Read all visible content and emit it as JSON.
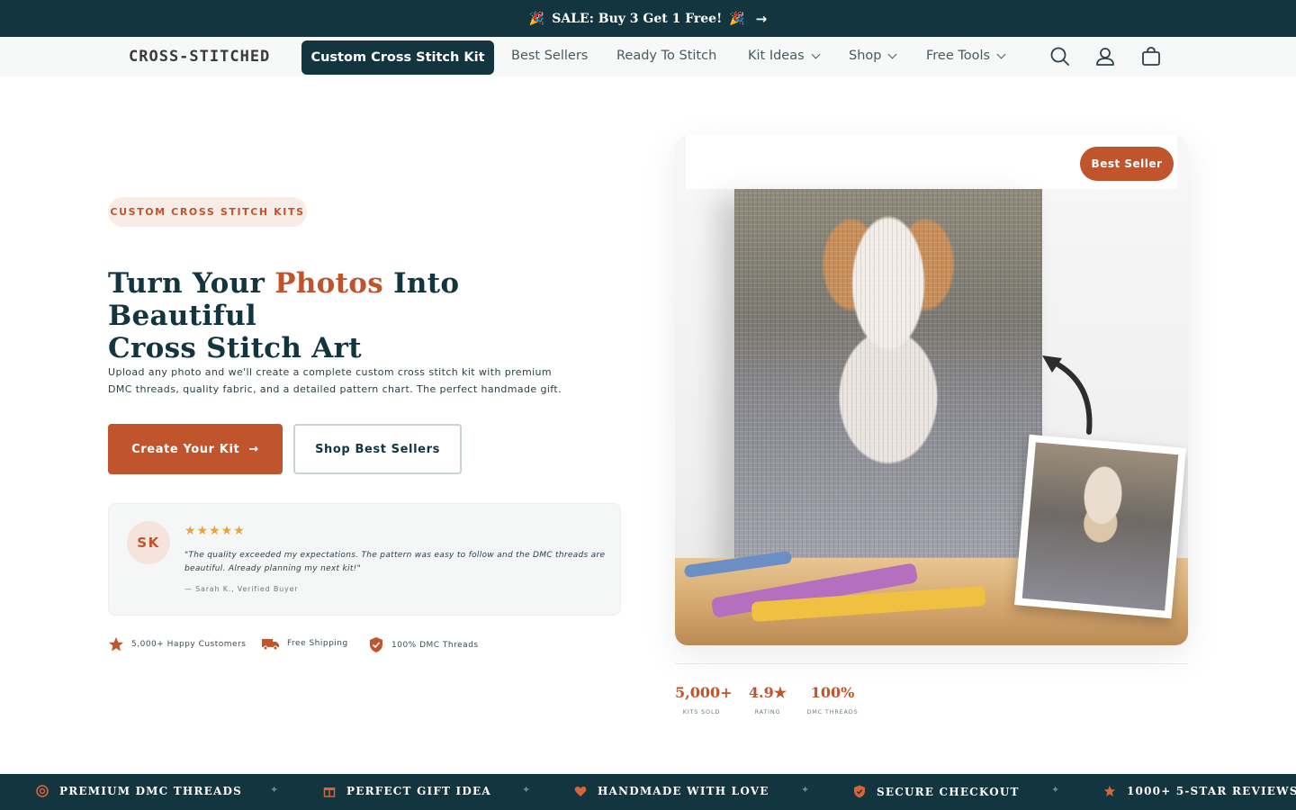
{
  "announcement": {
    "emoji_left": "🎉",
    "text": "SALE: Buy 3 Get 1 Free!",
    "emoji_right": "🎉",
    "arrow": "→"
  },
  "nav": {
    "logo": "CROSS-STITCHED",
    "primary_button": "Custom Cross Stitch Kit",
    "links": [
      {
        "label": "Best Sellers",
        "dropdown": false
      },
      {
        "label": "Ready To Stitch",
        "dropdown": false
      },
      {
        "label": "Kit Ideas",
        "dropdown": true
      },
      {
        "label": "Shop",
        "dropdown": true
      },
      {
        "label": "Free Tools",
        "dropdown": true
      }
    ],
    "icons": [
      "search-icon",
      "account-icon",
      "cart-icon"
    ]
  },
  "hero": {
    "tag": "CUSTOM CROSS STITCH KITS",
    "title_part1": "Turn Your ",
    "title_accent": "Photos",
    "title_part2": " Into Beautiful",
    "title_line2": "Cross Stitch Art",
    "description_line1": "Upload any photo and we'll create a complete custom cross stitch kit with premium",
    "description_line2": "DMC threads, quality fabric, and a detailed pattern chart. The perfect handmade gift.",
    "cta_primary": "Create Your Kit",
    "cta_primary_arrow": "→",
    "cta_secondary": "Shop Best Sellers"
  },
  "review": {
    "initials": "SK",
    "stars": "★★★★★",
    "quote_line1": "\"The quality exceeded my expectations. The pattern was easy to follow and the DMC threads are",
    "quote_line2": "beautiful. Already planning my next kit!\"",
    "author": "— Sarah K., Verified Buyer"
  },
  "trust": [
    {
      "icon": "star-icon",
      "label": "5,000+ Happy Customers"
    },
    {
      "icon": "truck-icon",
      "label": "Free Shipping"
    },
    {
      "icon": "shield-check-icon",
      "label": "100% DMC Threads"
    }
  ],
  "product": {
    "badge": "Best Seller"
  },
  "stats": [
    {
      "value": "5,000+",
      "label": "KITS SOLD"
    },
    {
      "value": "4.9★",
      "label": "RATING"
    },
    {
      "value": "100%",
      "label": "DMC THREADS"
    }
  ],
  "features": [
    {
      "icon": "thread-spool-icon",
      "label": "PREMIUM DMC THREADS"
    },
    {
      "icon": "gift-icon",
      "label": "PERFECT GIFT IDEA"
    },
    {
      "icon": "heart-icon",
      "label": "HANDMADE WITH LOVE"
    },
    {
      "icon": "shield-icon",
      "label": "SECURE CHECKOUT"
    },
    {
      "icon": "star-icon",
      "label": "1000+ 5-STAR REVIEWS"
    }
  ],
  "separator": "✦",
  "colors": {
    "navy": "#123540",
    "terracotta": "#c0542d",
    "tag_bg": "#f8ece6",
    "star": "#e8a33c"
  }
}
